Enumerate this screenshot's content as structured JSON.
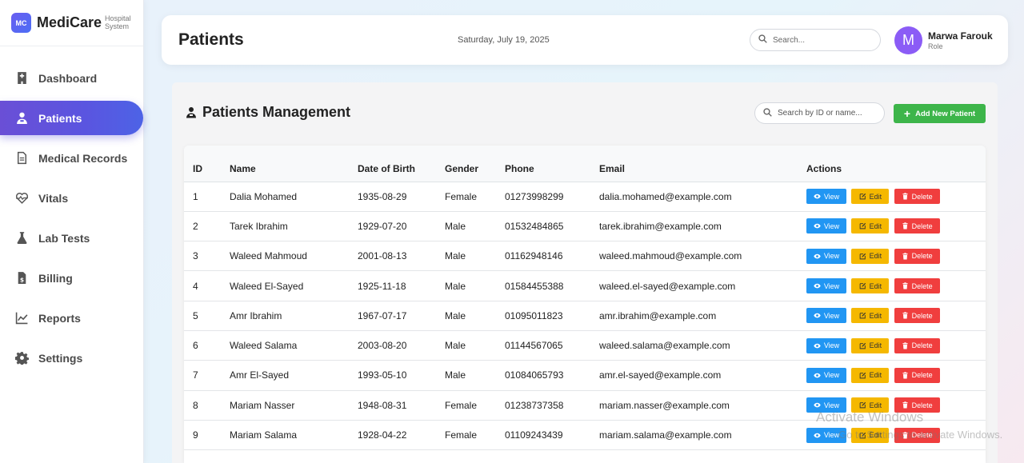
{
  "brand": {
    "logo_text": "MC",
    "name": "MediCare",
    "sub_line1": "Hospital",
    "sub_line2": "System"
  },
  "sidebar": {
    "items": [
      {
        "label": "Dashboard",
        "icon": "hospital-icon",
        "active": false
      },
      {
        "label": "Patients",
        "icon": "patient-icon",
        "active": true
      },
      {
        "label": "Medical Records",
        "icon": "file-icon",
        "active": false
      },
      {
        "label": "Vitals",
        "icon": "heartbeat-icon",
        "active": false
      },
      {
        "label": "Lab Tests",
        "icon": "flask-icon",
        "active": false
      },
      {
        "label": "Billing",
        "icon": "invoice-icon",
        "active": false
      },
      {
        "label": "Reports",
        "icon": "chart-line-icon",
        "active": false
      },
      {
        "label": "Settings",
        "icon": "gear-icon",
        "active": false
      }
    ]
  },
  "header": {
    "title": "Patients",
    "date": "Saturday, July 19, 2025",
    "search_placeholder": "Search...",
    "user": {
      "initial": "M",
      "name": "Marwa Farouk",
      "role": "Role",
      "avatar_color": "#8b5cf6"
    }
  },
  "main": {
    "title": "Patients Management",
    "search_placeholder": "Search by ID or name...",
    "add_button": "Add New Patient",
    "table": {
      "columns": [
        "ID",
        "Name",
        "Date of Birth",
        "Gender",
        "Phone",
        "Email",
        "Actions"
      ],
      "actions": {
        "view": "View",
        "edit": "Edit",
        "delete": "Delete"
      },
      "rows": [
        {
          "id": "1",
          "name": "Dalia Mohamed",
          "dob": "1935-08-29",
          "gender": "Female",
          "phone": "01273998299",
          "email": "dalia.mohamed@example.com"
        },
        {
          "id": "2",
          "name": "Tarek Ibrahim",
          "dob": "1929-07-20",
          "gender": "Male",
          "phone": "01532484865",
          "email": "tarek.ibrahim@example.com"
        },
        {
          "id": "3",
          "name": "Waleed Mahmoud",
          "dob": "2001-08-13",
          "gender": "Male",
          "phone": "01162948146",
          "email": "waleed.mahmoud@example.com"
        },
        {
          "id": "4",
          "name": "Waleed El-Sayed",
          "dob": "1925-11-18",
          "gender": "Male",
          "phone": "01584455388",
          "email": "waleed.el-sayed@example.com"
        },
        {
          "id": "5",
          "name": "Amr Ibrahim",
          "dob": "1967-07-17",
          "gender": "Male",
          "phone": "01095011823",
          "email": "amr.ibrahim@example.com"
        },
        {
          "id": "6",
          "name": "Waleed Salama",
          "dob": "2003-08-20",
          "gender": "Male",
          "phone": "01144567065",
          "email": "waleed.salama@example.com"
        },
        {
          "id": "7",
          "name": "Amr El-Sayed",
          "dob": "1993-05-10",
          "gender": "Male",
          "phone": "01084065793",
          "email": "amr.el-sayed@example.com"
        },
        {
          "id": "8",
          "name": "Mariam Nasser",
          "dob": "1948-08-31",
          "gender": "Female",
          "phone": "01238737358",
          "email": "mariam.nasser@example.com"
        },
        {
          "id": "9",
          "name": "Mariam Salama",
          "dob": "1928-04-22",
          "gender": "Female",
          "phone": "01109243439",
          "email": "mariam.salama@example.com"
        }
      ]
    }
  },
  "watermark": {
    "line1": "Activate Windows",
    "line2": "Go to Settings to activate Windows."
  },
  "colors": {
    "accent": "#5a55e0",
    "view": "#2196f3",
    "edit": "#f5b800",
    "delete": "#f03e3e",
    "add": "#3db54a"
  }
}
